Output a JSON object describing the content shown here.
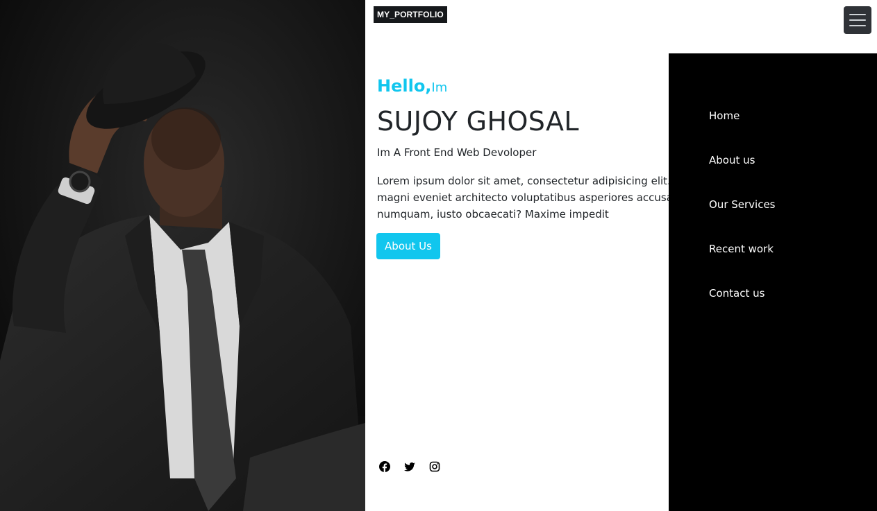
{
  "brand": "MY_PORTFOLIO",
  "hero": {
    "hello": "Hello,",
    "im": "Im",
    "name": "SUJOY GHOSAL",
    "role": "Im A Front End Web Devoloper",
    "lorem": "Lorem ipsum dolor sit amet, consectetur adipisicing elit. Quasi harum. Neque magni eveniet architecto voluptatibus asperiores accusantium delectus numquam, iusto obcaecati? Maxime impedit",
    "button_label": "About Us"
  },
  "nav": {
    "items": [
      {
        "label": "Home"
      },
      {
        "label": "About us"
      },
      {
        "label": "Our Services"
      },
      {
        "label": "Recent work"
      },
      {
        "label": "Contact us"
      }
    ]
  },
  "social": [
    "facebook-icon",
    "twitter-icon",
    "instagram-icon"
  ],
  "colors": {
    "accent": "#11c6ee",
    "nav_bg": "#000000",
    "text": "#212529"
  }
}
